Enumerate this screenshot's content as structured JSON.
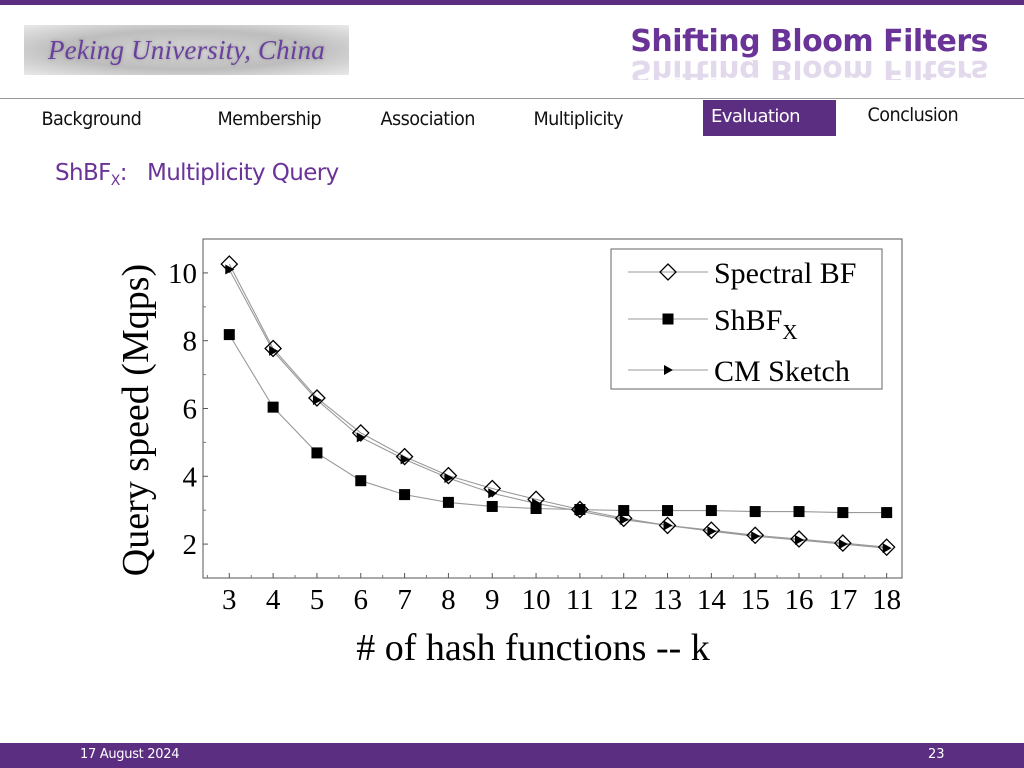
{
  "header": {
    "logo_text": "Peking University, China",
    "title": "Shifting Bloom Filters"
  },
  "nav": {
    "items": [
      {
        "label": "Background",
        "active": false
      },
      {
        "label": "Membership",
        "active": false
      },
      {
        "label": "Association",
        "active": false
      },
      {
        "label": "Multiplicity",
        "active": false
      },
      {
        "label": "Evaluation",
        "active": true
      },
      {
        "label": "Conclusion",
        "active": false
      }
    ]
  },
  "slide": {
    "subtitle_prefix": "ShBF",
    "subtitle_sub": "X",
    "subtitle_colon": ":",
    "subtitle_text": "Multiplicity Query"
  },
  "colors": {
    "brand_purple": "#5c2e82",
    "title_purple": "#6a3398"
  },
  "chart_data": {
    "type": "line",
    "title": "",
    "xlabel": "# of hash functions -- k",
    "ylabel": "Query speed (Mqps)",
    "x": [
      3,
      4,
      5,
      6,
      7,
      8,
      9,
      10,
      11,
      12,
      13,
      14,
      15,
      16,
      17,
      18
    ],
    "xlim": [
      2.4,
      18.35
    ],
    "ylim": [
      1.0,
      11.0
    ],
    "xticks": [
      "3",
      "4",
      "5",
      "6",
      "7",
      "8",
      "9",
      "10",
      "11",
      "12",
      "13",
      "14",
      "15",
      "16",
      "17",
      "18"
    ],
    "yticks": [
      "2",
      "4",
      "6",
      "8",
      "10"
    ],
    "ytick_values": [
      2,
      4,
      6,
      8,
      10
    ],
    "grid": false,
    "legend_position": "top-right",
    "series": [
      {
        "name": "Spectral BF",
        "name_sub": "",
        "marker": "diamond-open",
        "values": [
          10.26,
          7.77,
          6.31,
          5.28,
          4.58,
          4.02,
          3.64,
          3.32,
          3.02,
          2.76,
          2.55,
          2.41,
          2.26,
          2.15,
          2.03,
          1.91
        ]
      },
      {
        "name": "ShBF",
        "name_sub": "X",
        "marker": "square-filled",
        "values": [
          8.18,
          6.04,
          4.69,
          3.87,
          3.46,
          3.23,
          3.11,
          3.05,
          3.02,
          2.99,
          2.99,
          2.99,
          2.96,
          2.96,
          2.93,
          2.93
        ]
      },
      {
        "name": "CM Sketch",
        "name_sub": "",
        "marker": "triangle-right-filled",
        "values": [
          10.1,
          7.7,
          6.25,
          5.15,
          4.5,
          3.95,
          3.5,
          3.2,
          2.97,
          2.72,
          2.55,
          2.38,
          2.23,
          2.12,
          2.0,
          1.88
        ]
      }
    ]
  },
  "footer": {
    "date": "17 August 2024",
    "page": "23"
  }
}
